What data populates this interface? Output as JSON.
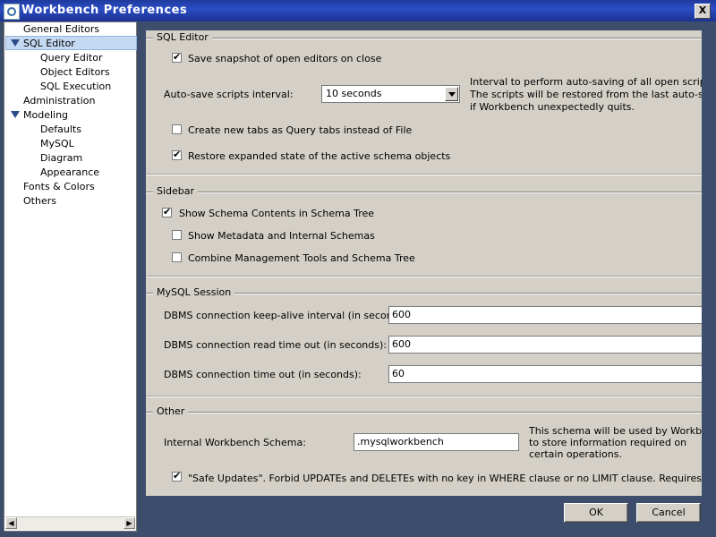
{
  "window": {
    "title": "Workbench Preferences",
    "close_label": "X"
  },
  "sidebar": {
    "items": [
      {
        "label": "General Editors"
      },
      {
        "label": "SQL Editor"
      },
      {
        "label": "Query Editor"
      },
      {
        "label": "Object Editors"
      },
      {
        "label": "SQL Execution"
      },
      {
        "label": "Administration"
      },
      {
        "label": "Modeling"
      },
      {
        "label": "Defaults"
      },
      {
        "label": "MySQL"
      },
      {
        "label": "Diagram"
      },
      {
        "label": "Appearance"
      },
      {
        "label": "Fonts & Colors"
      },
      {
        "label": "Others"
      }
    ]
  },
  "sql_editor": {
    "title": "SQL Editor",
    "save_snapshot": {
      "label": "Save snapshot of open editors on close",
      "checked": true
    },
    "autosave_label": "Auto-save scripts interval:",
    "autosave_value": "10 seconds",
    "autosave_help": [
      "Interval to perform auto-saving of all open script tabs.",
      "The scripts will be restored from the last auto-saved v",
      "if Workbench unexpectedly quits."
    ],
    "query_tabs": {
      "label": "Create new tabs as Query tabs instead of File",
      "checked": false
    },
    "restore_state": {
      "label": "Restore expanded state of the active schema objects",
      "checked": true
    }
  },
  "sidebar_group": {
    "title": "Sidebar",
    "show_schema_contents": {
      "label": "Show Schema Contents in Schema Tree",
      "checked": true
    },
    "show_metadata": {
      "label": "Show Metadata and Internal Schemas",
      "checked": false
    },
    "combine_tools": {
      "label": "Combine Management Tools and Schema Tree",
      "checked": false
    }
  },
  "mysql_session": {
    "title": "MySQL Session",
    "keepalive_label": "DBMS connection keep-alive interval (in seconds):",
    "keepalive_value": "600",
    "read_timeout_label": "DBMS connection read time out (in seconds):",
    "read_timeout_value": "600",
    "timeout_label": "DBMS connection time out (in seconds):",
    "timeout_value": "60"
  },
  "other": {
    "title": "Other",
    "schema_label": "Internal Workbench Schema:",
    "schema_value": ".mysqlworkbench",
    "schema_help": [
      "This schema will be used by Workbench",
      "to store information required on",
      "certain operations."
    ],
    "safe_updates": {
      "label": "\"Safe Updates\". Forbid UPDATEs and DELETEs with no key in WHERE clause or no LIMIT clause. Requires a reconnection.",
      "checked": true
    }
  },
  "buttons": {
    "ok": "OK",
    "cancel": "Cancel"
  }
}
